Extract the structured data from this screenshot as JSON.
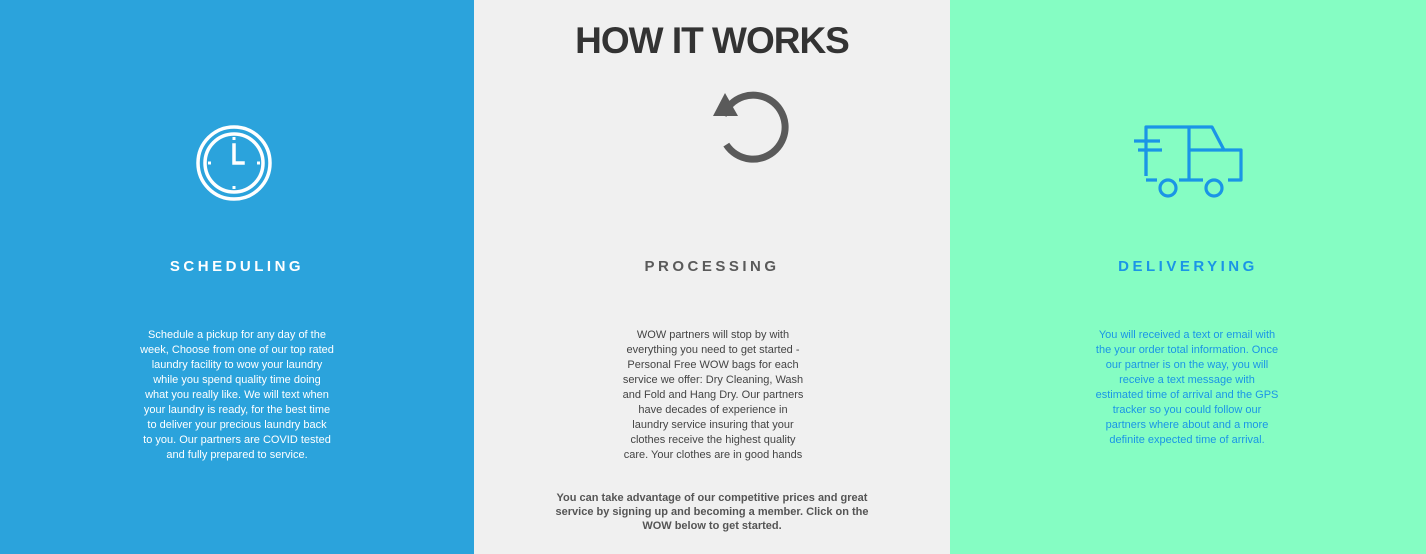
{
  "header": {
    "title": "HOW IT WORKS"
  },
  "steps": [
    {
      "icon": "clock-icon",
      "heading": "SCHEDULING",
      "description": "Schedule a pickup for any day of the\nweek, Choose from one of our top rated\nlaundry facility to wow your laundry\nwhile you spend quality time doing\nwhat you really like. We will text when\nyour laundry is ready, for the best time\nto deliver  your precious laundry back\nto you. Our partners are COVID tested\nand fully prepared to service.",
      "background": "#2ba3dc",
      "text_color": "#ffffff"
    },
    {
      "icon": "refresh-icon",
      "heading": "PROCESSING",
      "description": "WOW partners will stop by with\neverything you need to get started -\nPersonal Free WOW bags for each\nservice we offer: Dry Cleaning, Wash\nand Fold and Hang Dry. Our partners\nhave decades of experience in\nlaundry service insuring that your\nclothes receive the highest quality\ncare. Your clothes are in good hands",
      "background": "#f0f0f0",
      "text_color": "#444444"
    },
    {
      "icon": "delivery-truck-icon",
      "heading": "DELIVERYING",
      "description": "You will received a text or email with\nthe your order total information. Once\nour partner is on the way, you will\nreceive a text message with\nestimated time of arrival and the GPS\ntracker so you could follow our\npartners where about and a more\ndefinite expected time of arrival.",
      "background": "#85fdc3",
      "text_color": "#1a95e6"
    }
  ],
  "cta": {
    "text": "You can take advantage of our competitive prices and great\nservice by signing up and becoming a member. Click on the\nWOW below to get started."
  }
}
